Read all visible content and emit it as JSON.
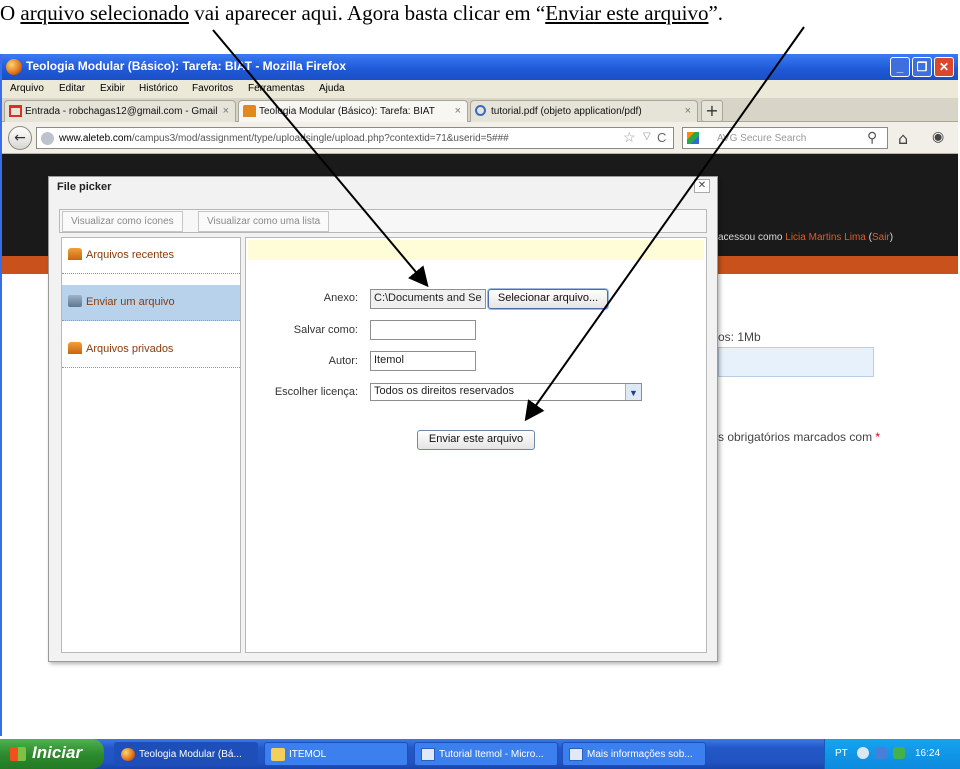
{
  "caption": {
    "part1": "O ",
    "part2": "arquivo selecionado",
    "part3": " vai aparecer aqui. Agora basta clicar em “",
    "part4": "Enviar este arquivo",
    "part5": "”."
  },
  "window": {
    "title": "Teologia Modular (Básico): Tarefa: BIAT - Mozilla Firefox",
    "min": "_",
    "max": "❒",
    "close": "✕"
  },
  "menu": [
    "Arquivo",
    "Editar",
    "Exibir",
    "Histórico",
    "Favoritos",
    "Ferramentas",
    "Ajuda"
  ],
  "tabs": [
    {
      "label": "Entrada - robchagas12@gmail.com - Gmail",
      "close": "×"
    },
    {
      "label": "Teologia Modular (Básico): Tarefa: BIAT",
      "close": "×"
    },
    {
      "label": "tutorial.pdf (objeto application/pdf)",
      "close": "×"
    }
  ],
  "newtab": "+",
  "nav": {
    "back": "←",
    "url_domain": "www.aleteb.com",
    "url_path": "/campus3/mod/assignment/type/uploadsingle/upload.php?contextid=71&userid=5###",
    "search_placeholder": "AVG Secure Search",
    "star": "☆",
    "dropdown": "▽",
    "reload": "C",
    "search_icon": "⚲",
    "home_icon": "⌂",
    "eye_icon": "◉"
  },
  "page": {
    "login_prefix": "acessou como ",
    "login_name": "Licia Martins Lima",
    "login_open": " (",
    "login_exit": "Sair",
    "login_close": ")",
    "max_size": "os: 1Mb",
    "required": "s obrigatórios marcados com ",
    "required_star": "*"
  },
  "filepicker": {
    "title": "File picker",
    "close": "✕",
    "view_icons": "Visualizar como ícones",
    "view_list": "Visualizar como uma lista",
    "repos": [
      {
        "label": "Arquivos recentes",
        "icon": "moodle-icon"
      },
      {
        "label": "Enviar um arquivo",
        "icon": "upload-icon"
      },
      {
        "label": "Arquivos privados",
        "icon": "moodle-icon"
      }
    ],
    "form": {
      "anexo_label": "Anexo:",
      "anexo_value": "C:\\Documents and Se",
      "select_button": "Selecionar arquivo...",
      "salvar_label": "Salvar como:",
      "salvar_value": "",
      "autor_label": "Autor:",
      "autor_value": "Itemol",
      "licenca_label": "Escolher licença:",
      "licenca_value": "Todos os direitos reservados",
      "submit_button": "Enviar este arquivo"
    }
  },
  "taskbar": {
    "start": "Iniciar",
    "items": [
      {
        "label": "Teologia Modular (Bá...",
        "icon": "firefox-icon"
      },
      {
        "label": "ITEMOL",
        "icon": "folder-icon"
      },
      {
        "label": "Tutorial Itemol - Micro...",
        "icon": "word-icon"
      },
      {
        "label": "Mais informações sob...",
        "icon": "word-icon"
      }
    ],
    "lang": "PT",
    "clock": "16:24"
  },
  "colors": {
    "accent_orange": "#c9521c",
    "selected_repo": "#b8d2ec",
    "header_dark": "#1a1a1a"
  }
}
